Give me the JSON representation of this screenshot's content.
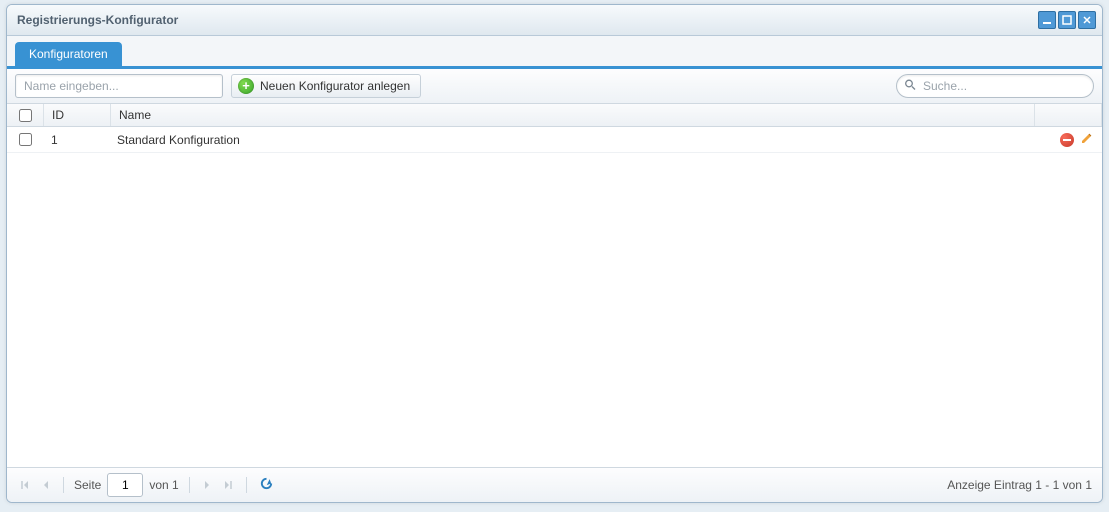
{
  "window": {
    "title": "Registrierungs-Konfigurator"
  },
  "tabs": [
    {
      "label": "Konfiguratoren"
    }
  ],
  "toolbar": {
    "name_placeholder": "Name eingeben...",
    "add_label": "Neuen Konfigurator anlegen",
    "search_placeholder": "Suche..."
  },
  "grid": {
    "headers": {
      "id": "ID",
      "name": "Name"
    },
    "rows": [
      {
        "id": "1",
        "name": "Standard Konfiguration"
      }
    ]
  },
  "pager": {
    "page_label": "Seite",
    "current_page": "1",
    "of_label": "von 1",
    "summary": "Anzeige Eintrag 1 - 1 von 1"
  }
}
